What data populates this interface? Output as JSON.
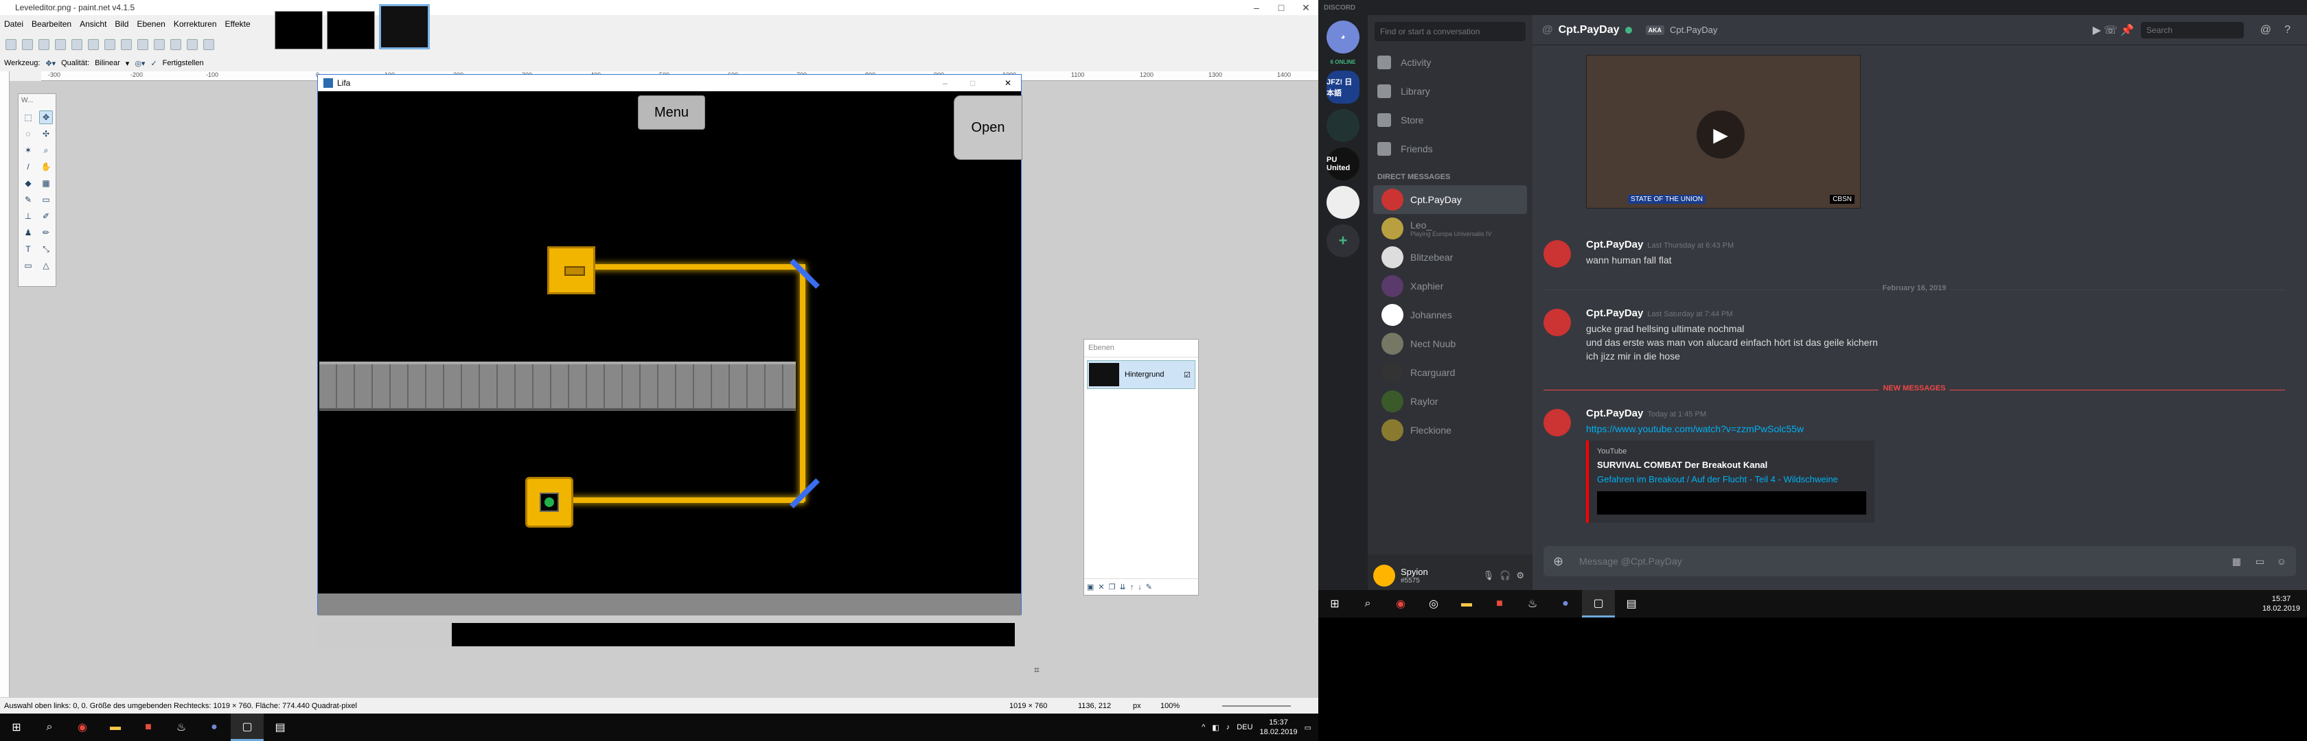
{
  "paintnet": {
    "title": "Leveleditor.png - paint.net v4.1.5",
    "menu": [
      "Datei",
      "Bearbeiten",
      "Ansicht",
      "Bild",
      "Ebenen",
      "Korrekturen",
      "Effekte"
    ],
    "toolbar2": {
      "werkzeug": "Werkzeug:",
      "qualitaet": "Qualität:",
      "qualitaet_value": "Bilinear",
      "fertig": "Fertigstellen"
    },
    "ruler_marks": [
      "-300",
      "-200",
      "-100",
      "0",
      "100",
      "200",
      "300",
      "400",
      "500",
      "600",
      "700",
      "800",
      "900",
      "1000",
      "1100",
      "1200",
      "1300",
      "1400"
    ],
    "tools_header": "W...",
    "layers": {
      "header": "Ebenen",
      "layer_name": "Hintergrund"
    },
    "status": {
      "text": "Auswahl oben links: 0, 0. Größe des umgebenden Rechtecks: 1019 × 760. Fläche: 774.440 Quadrat-pixel",
      "size": "1019 × 760",
      "coords": "1136, 212",
      "unit": "px",
      "zoom": "100%"
    }
  },
  "game": {
    "title": "Lifa",
    "menu_button": "Menu",
    "open_button": "Open"
  },
  "taskbar_left": {
    "lang": "DEU",
    "time": "15:37",
    "date": "18.02.2019"
  },
  "taskbar_right": {
    "time": "15:37",
    "date": "18.02.2019"
  },
  "discord": {
    "app_title": "DISCORD",
    "online_count": "6 ONLINE",
    "guilds": [
      "JFZ! 日本語",
      "",
      "PU United",
      ""
    ],
    "search_placeholder": "Find or start a conversation",
    "nav": [
      "Activity",
      "Library",
      "Store",
      "Friends"
    ],
    "dm_header": "DIRECT MESSAGES",
    "dms": [
      {
        "name": "Cpt.PayDay",
        "sub": ""
      },
      {
        "name": "Leo_",
        "sub": "Playing Europa Universalis IV"
      },
      {
        "name": "Blitzebear",
        "sub": ""
      },
      {
        "name": "Xaphier",
        "sub": ""
      },
      {
        "name": "Johannes",
        "sub": ""
      },
      {
        "name": "Nect Nuub",
        "sub": ""
      },
      {
        "name": "Rcarguard",
        "sub": ""
      },
      {
        "name": "Raylor",
        "sub": ""
      },
      {
        "name": "Fleckione",
        "sub": ""
      }
    ],
    "user": {
      "name": "Spyion",
      "tag": "#5575"
    },
    "chat": {
      "title": "Cpt.PayDay",
      "aka_badge": "AKA",
      "alias": "Cpt.PayDay",
      "search": "Search",
      "video_caption": "STATE OF THE UNION",
      "video_network": "CBSN",
      "msg1": {
        "name": "Cpt.PayDay",
        "time": "Last Thursday at 6:43 PM",
        "lines": [
          "wann human fall flat"
        ]
      },
      "date_divider": "February 16, 2019",
      "msg2": {
        "name": "Cpt.PayDay",
        "time": "Last Saturday at 7:44 PM",
        "lines": [
          "gucke grad hellsing ultimate nochmal",
          "und das erste was man von alucard einfach hört ist das geile kichern",
          "ich jizz mir in die hose"
        ]
      },
      "new_divider": "NEW MESSAGES",
      "msg3": {
        "name": "Cpt.PayDay",
        "time": "Today at 1:45 PM",
        "link": "https://www.youtube.com/watch?v=zzmPwSolc55w"
      },
      "embed": {
        "provider": "YouTube",
        "title": "SURVIVAL COMBAT Der Breakout Kanal",
        "desc": "Gefahren im Breakout / Auf der Flucht - Teil 4 - Wildschweine"
      },
      "composer": "Message @Cpt.PayDay"
    }
  }
}
